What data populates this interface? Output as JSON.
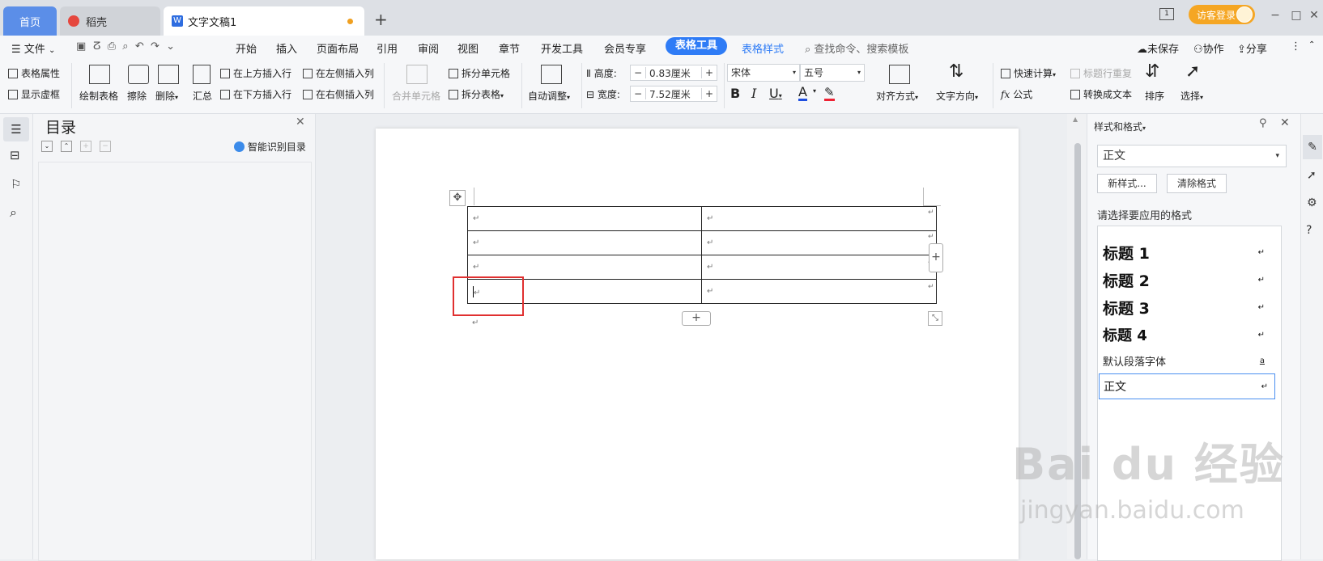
{
  "tabs": {
    "home": "首页",
    "wps": "稻壳",
    "doc": "文字文稿1",
    "doc_logo": "W",
    "new_tab": "+"
  },
  "titlebar": {
    "login": "访客登录",
    "window_badge": "1",
    "min": "−",
    "max": "□",
    "close": "✕"
  },
  "menu": {
    "file": "文件",
    "items": [
      "开始",
      "插入",
      "页面布局",
      "引用",
      "审阅",
      "视图",
      "章节",
      "开发工具",
      "会员专享"
    ],
    "active": "表格工具",
    "table_style": "表格样式",
    "search": "查找命令、搜索模板",
    "unsaved": "未保存",
    "collab": "协作",
    "share": "分享"
  },
  "ribbon": {
    "table_props": "表格属性",
    "show_grid": "显示虚框",
    "draw_table": "绘制表格",
    "erase": "擦除",
    "delete": "删除",
    "summary": "汇总",
    "insert_row_above": "在上方插入行",
    "insert_row_below": "在下方插入行",
    "insert_col_left": "在左侧插入列",
    "insert_col_right": "在右侧插入列",
    "merge_cells": "合并单元格",
    "split_cells": "拆分单元格",
    "split_table": "拆分表格",
    "auto_fit": "自动调整",
    "height_label": "高度:",
    "height_value": "0.83厘米",
    "width_label": "宽度:",
    "width_value": "7.52厘米",
    "font": "宋体",
    "size": "五号",
    "bold": "B",
    "italic": "I",
    "underline": "U",
    "font_color": "A",
    "align": "对齐方式",
    "text_dir": "文字方向",
    "quick_calc": "快速计算",
    "formula": "公式",
    "repeat_header": "标题行重复",
    "to_text": "转换成文本",
    "sort": "排序",
    "select": "选择"
  },
  "toc": {
    "title": "目录",
    "smart": "智能识别目录"
  },
  "document": {
    "para_mark": "↵",
    "rows": 4,
    "cols": 2,
    "add": "+"
  },
  "styles_panel": {
    "title": "样式和格式",
    "current": "正文",
    "new_style": "新样式...",
    "clear_format": "清除格式",
    "prompt": "请选择要应用的格式",
    "items": [
      "标题 1",
      "标题 2",
      "标题 3",
      "标题 4",
      "默认段落字体",
      "正文"
    ],
    "item_marks": [
      "↵",
      "↵",
      "↵",
      "↵",
      "a",
      "↵"
    ]
  },
  "watermark": {
    "brand": "Bai du 经验",
    "url": "jingyan.baidu.com"
  }
}
